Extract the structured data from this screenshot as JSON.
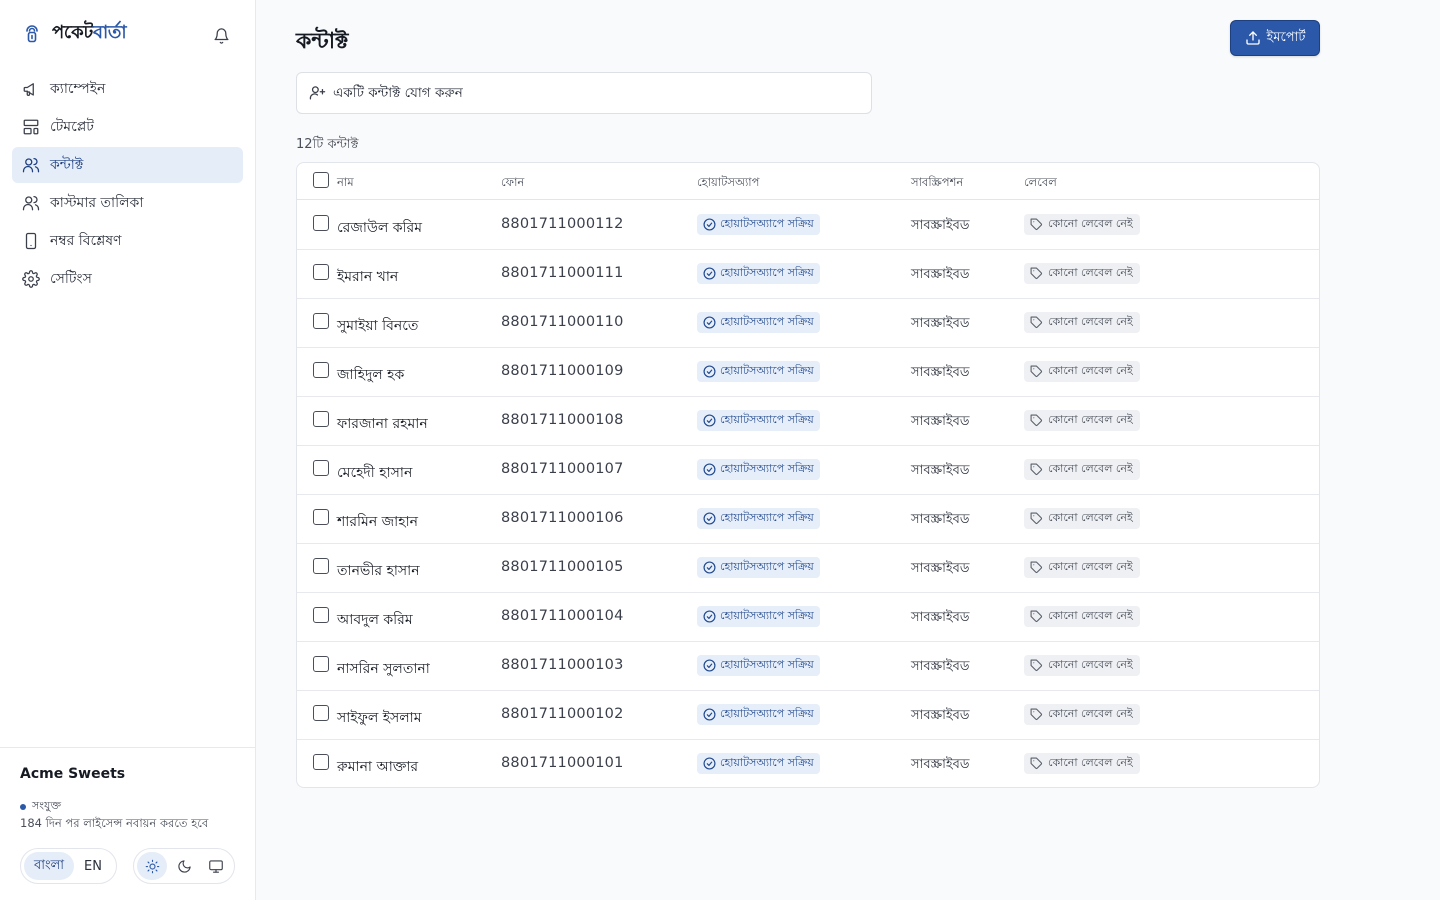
{
  "brand": {
    "name_part1": "পকেট",
    "name_part2": "বার্তা"
  },
  "sidebar": {
    "items": [
      {
        "label": "ক্যাম্পেইন",
        "icon": "megaphone-icon"
      },
      {
        "label": "টেমপ্লেট",
        "icon": "layout-template-icon"
      },
      {
        "label": "কন্টাক্ট",
        "icon": "users-icon",
        "active": true
      },
      {
        "label": "কাস্টমার তালিকা",
        "icon": "user-list-icon"
      },
      {
        "label": "নম্বর বিশ্লেষণ",
        "icon": "smartphone-icon"
      },
      {
        "label": "সেটিংস",
        "icon": "gear-icon"
      }
    ],
    "footer": {
      "org_name": "Acme Sweets",
      "status": "সংযুক্ত",
      "license_note": "184 দিন পর লাইসেন্স নবায়ন করতে হবে",
      "lang_bn": "বাংলা",
      "lang_en": "EN"
    }
  },
  "main": {
    "title": "কন্টাক্ট",
    "import_label": "ইমপোর্ট",
    "add_contact_label": "একটি কন্টাক্ট যোগ করুন",
    "count_text": "12টি কন্টাক্ট",
    "columns": {
      "name": "নাম",
      "phone": "ফোন",
      "whatsapp": "হোয়াটসঅ্যাপ",
      "subscription": "সাবস্ক্রিপশন",
      "label": "লেবেল"
    },
    "rows": [
      {
        "name": "রেজাউল করিম",
        "phone": "8801711000112",
        "whatsapp": "হোয়াটসঅ্যাপে সক্রিয়",
        "subscription": "সাবস্ক্রাইবড",
        "label": "কোনো লেবেল নেই"
      },
      {
        "name": "ইমরান খান",
        "phone": "8801711000111",
        "whatsapp": "হোয়াটসঅ্যাপে সক্রিয়",
        "subscription": "সাবস্ক্রাইবড",
        "label": "কোনো লেবেল নেই"
      },
      {
        "name": "সুমাইয়া বিনতে",
        "phone": "8801711000110",
        "whatsapp": "হোয়াটসঅ্যাপে সক্রিয়",
        "subscription": "সাবস্ক্রাইবড",
        "label": "কোনো লেবেল নেই"
      },
      {
        "name": "জাহিদুল হক",
        "phone": "8801711000109",
        "whatsapp": "হোয়াটসঅ্যাপে সক্রিয়",
        "subscription": "সাবস্ক্রাইবড",
        "label": "কোনো লেবেল নেই"
      },
      {
        "name": "ফারজানা রহমান",
        "phone": "8801711000108",
        "whatsapp": "হোয়াটসঅ্যাপে সক্রিয়",
        "subscription": "সাবস্ক্রাইবড",
        "label": "কোনো লেবেল নেই"
      },
      {
        "name": "মেহেদী হাসান",
        "phone": "8801711000107",
        "whatsapp": "হোয়াটসঅ্যাপে সক্রিয়",
        "subscription": "সাবস্ক্রাইবড",
        "label": "কোনো লেবেল নেই"
      },
      {
        "name": "শারমিন জাহান",
        "phone": "8801711000106",
        "whatsapp": "হোয়াটসঅ্যাপে সক্রিয়",
        "subscription": "সাবস্ক্রাইবড",
        "label": "কোনো লেবেল নেই"
      },
      {
        "name": "তানভীর হাসান",
        "phone": "8801711000105",
        "whatsapp": "হোয়াটসঅ্যাপে সক্রিয়",
        "subscription": "সাবস্ক্রাইবড",
        "label": "কোনো লেবেল নেই"
      },
      {
        "name": "আবদুল করিম",
        "phone": "8801711000104",
        "whatsapp": "হোয়াটসঅ্যাপে সক্রিয়",
        "subscription": "সাবস্ক্রাইবড",
        "label": "কোনো লেবেল নেই"
      },
      {
        "name": "নাসরিন সুলতানা",
        "phone": "8801711000103",
        "whatsapp": "হোয়াটসঅ্যাপে সক্রিয়",
        "subscription": "সাবস্ক্রাইবড",
        "label": "কোনো লেবেল নেই"
      },
      {
        "name": "সাইফুল ইসলাম",
        "phone": "8801711000102",
        "whatsapp": "হোয়াটসঅ্যাপে সক্রিয়",
        "subscription": "সাবস্ক্রাইবড",
        "label": "কোনো লেবেল নেই"
      },
      {
        "name": "রুমানা আক্তার",
        "phone": "8801711000101",
        "whatsapp": "হোয়াটসঅ্যাপে সক্রিয়",
        "subscription": "সাবস্ক্রাইবড",
        "label": "কোনো লেবেল নেই"
      }
    ]
  },
  "colors": {
    "accent": "#2b58a8",
    "active_nav_bg": "#e5edf8",
    "whatsapp_badge_bg": "#e6eef9",
    "label_badge_bg": "#eef0f3"
  }
}
